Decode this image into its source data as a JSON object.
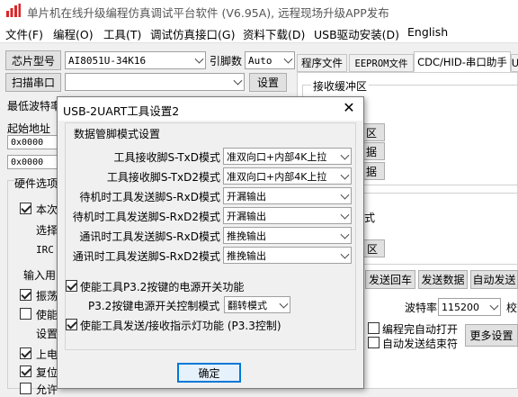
{
  "window": {
    "title": "单片机在线升级编程仿真调试平台软件 (V6.95A), 远程现场升级APP发布"
  },
  "menu": [
    "文件(F)",
    "编程(O)",
    "工具(T)",
    "调试仿真接口(G)",
    "资料下载(D)",
    "USB驱动安装(D)",
    "English"
  ],
  "left": {
    "chip_label": "芯片型号",
    "chip_value": "AI8051U-34K16",
    "pin_label": "引脚数",
    "pin_value": "Auto",
    "scan_button": "扫描串口",
    "port_value": "",
    "settings_button": "设置",
    "min_baud_label": "最低波特率",
    "start_addr_label": "起始地址",
    "start_addr_value": "0x0000",
    "addr2_value": "0x0000",
    "hw_options_label": "硬件选项",
    "opt_fragments": [
      "本次",
      "选择",
      "IRC",
      "输入用",
      "振荡",
      "使能",
      "设置",
      "上电",
      "复位",
      "允许"
    ]
  },
  "tabs": [
    "程序文件",
    "EEPROM文件",
    "CDC/HID-串口助手",
    "U"
  ],
  "right": {
    "recv_buffer_label": "接收缓冲区",
    "buttons_region": [
      "区",
      "据",
      "据"
    ],
    "mode_label": "式",
    "clear_label": "区",
    "send_back": "发送回车",
    "send_data": "发送数据",
    "auto_send": "自动发送",
    "baud_label": "波特率",
    "baud_value": "115200",
    "check_label": "校",
    "auto_open": "编程完自动打开",
    "auto_end": "自动发送结束符",
    "more_settings": "更多设置"
  },
  "dialog": {
    "title": "USB-2UART工具设置2",
    "close_glyph": "✕",
    "group_label": "数据管脚模式设置",
    "rows": [
      {
        "label": "工具接收脚S-TxD模式",
        "value": "准双向口+内部4K上拉"
      },
      {
        "label": "工具接收脚S-TxD2模式",
        "value": "准双向口+内部4K上拉"
      },
      {
        "label": "待机时工具发送脚S-RxD模式",
        "value": "开漏输出"
      },
      {
        "label": "待机时工具发送脚S-RxD2模式",
        "value": "开漏输出"
      },
      {
        "label": "通讯时工具发送脚S-RxD模式",
        "value": "推挽输出"
      },
      {
        "label": "通讯时工具发送脚S-RxD2模式",
        "value": "推挽输出"
      }
    ],
    "power_enable_label": "使能工具P3.2按键的电源开关功能",
    "power_enable_checked": true,
    "power_mode_label": "P3.2按键电源开关控制模式",
    "power_mode_value": "翻转模式",
    "indicator_label": "使能工具发送/接收指示灯功能 (P3.3控制)",
    "indicator_checked": true,
    "ok_button": "确定"
  },
  "colors": {
    "title_text": "#555555",
    "button_face": "#e1e1e1",
    "ok_border": "#0078d7",
    "icon_red": "#d9262a"
  },
  "icons": {
    "app": "app-logo-icon",
    "close": "close-icon",
    "dropdown": "chevron-down-icon"
  }
}
